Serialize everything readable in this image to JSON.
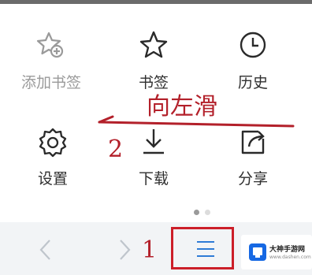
{
  "menu": {
    "items": [
      {
        "label": "添加书签",
        "icon": "bookmark-add-icon",
        "enabled": false
      },
      {
        "label": "书签",
        "icon": "star-icon",
        "enabled": true
      },
      {
        "label": "历史",
        "icon": "clock-icon",
        "enabled": true
      },
      {
        "label": "设置",
        "icon": "gear-icon",
        "enabled": true
      },
      {
        "label": "下载",
        "icon": "download-icon",
        "enabled": true
      },
      {
        "label": "分享",
        "icon": "share-icon",
        "enabled": true
      }
    ]
  },
  "annotations": {
    "swipe_text": "向左滑",
    "step_two": "2",
    "step_one": "1",
    "color": "#b3202a"
  },
  "pager": {
    "pages": 2,
    "current": 1
  },
  "bottom_bar": {
    "back_icon": "chevron-left-icon",
    "forward_icon": "chevron-right-icon",
    "menu_icon": "hamburger-menu-icon",
    "accent": "#2e7bd6"
  },
  "watermark": {
    "name": "大神手游网",
    "url": "www.dashen.com"
  }
}
